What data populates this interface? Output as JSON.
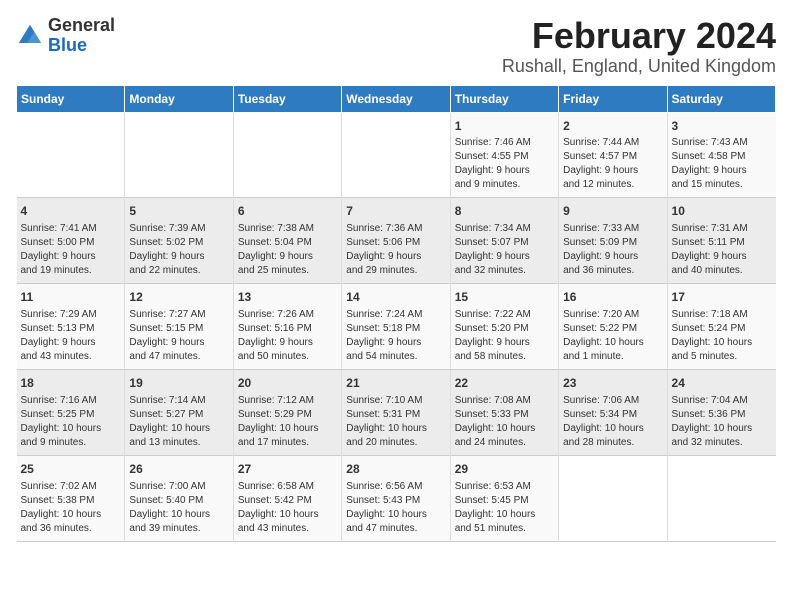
{
  "logo": {
    "general": "General",
    "blue": "Blue"
  },
  "title": "February 2024",
  "location": "Rushall, England, United Kingdom",
  "days_of_week": [
    "Sunday",
    "Monday",
    "Tuesday",
    "Wednesday",
    "Thursday",
    "Friday",
    "Saturday"
  ],
  "weeks": [
    [
      {
        "day": "",
        "content": ""
      },
      {
        "day": "",
        "content": ""
      },
      {
        "day": "",
        "content": ""
      },
      {
        "day": "",
        "content": ""
      },
      {
        "day": "1",
        "content": "Sunrise: 7:46 AM\nSunset: 4:55 PM\nDaylight: 9 hours\nand 9 minutes."
      },
      {
        "day": "2",
        "content": "Sunrise: 7:44 AM\nSunset: 4:57 PM\nDaylight: 9 hours\nand 12 minutes."
      },
      {
        "day": "3",
        "content": "Sunrise: 7:43 AM\nSunset: 4:58 PM\nDaylight: 9 hours\nand 15 minutes."
      }
    ],
    [
      {
        "day": "4",
        "content": "Sunrise: 7:41 AM\nSunset: 5:00 PM\nDaylight: 9 hours\nand 19 minutes."
      },
      {
        "day": "5",
        "content": "Sunrise: 7:39 AM\nSunset: 5:02 PM\nDaylight: 9 hours\nand 22 minutes."
      },
      {
        "day": "6",
        "content": "Sunrise: 7:38 AM\nSunset: 5:04 PM\nDaylight: 9 hours\nand 25 minutes."
      },
      {
        "day": "7",
        "content": "Sunrise: 7:36 AM\nSunset: 5:06 PM\nDaylight: 9 hours\nand 29 minutes."
      },
      {
        "day": "8",
        "content": "Sunrise: 7:34 AM\nSunset: 5:07 PM\nDaylight: 9 hours\nand 32 minutes."
      },
      {
        "day": "9",
        "content": "Sunrise: 7:33 AM\nSunset: 5:09 PM\nDaylight: 9 hours\nand 36 minutes."
      },
      {
        "day": "10",
        "content": "Sunrise: 7:31 AM\nSunset: 5:11 PM\nDaylight: 9 hours\nand 40 minutes."
      }
    ],
    [
      {
        "day": "11",
        "content": "Sunrise: 7:29 AM\nSunset: 5:13 PM\nDaylight: 9 hours\nand 43 minutes."
      },
      {
        "day": "12",
        "content": "Sunrise: 7:27 AM\nSunset: 5:15 PM\nDaylight: 9 hours\nand 47 minutes."
      },
      {
        "day": "13",
        "content": "Sunrise: 7:26 AM\nSunset: 5:16 PM\nDaylight: 9 hours\nand 50 minutes."
      },
      {
        "day": "14",
        "content": "Sunrise: 7:24 AM\nSunset: 5:18 PM\nDaylight: 9 hours\nand 54 minutes."
      },
      {
        "day": "15",
        "content": "Sunrise: 7:22 AM\nSunset: 5:20 PM\nDaylight: 9 hours\nand 58 minutes."
      },
      {
        "day": "16",
        "content": "Sunrise: 7:20 AM\nSunset: 5:22 PM\nDaylight: 10 hours\nand 1 minute."
      },
      {
        "day": "17",
        "content": "Sunrise: 7:18 AM\nSunset: 5:24 PM\nDaylight: 10 hours\nand 5 minutes."
      }
    ],
    [
      {
        "day": "18",
        "content": "Sunrise: 7:16 AM\nSunset: 5:25 PM\nDaylight: 10 hours\nand 9 minutes."
      },
      {
        "day": "19",
        "content": "Sunrise: 7:14 AM\nSunset: 5:27 PM\nDaylight: 10 hours\nand 13 minutes."
      },
      {
        "day": "20",
        "content": "Sunrise: 7:12 AM\nSunset: 5:29 PM\nDaylight: 10 hours\nand 17 minutes."
      },
      {
        "day": "21",
        "content": "Sunrise: 7:10 AM\nSunset: 5:31 PM\nDaylight: 10 hours\nand 20 minutes."
      },
      {
        "day": "22",
        "content": "Sunrise: 7:08 AM\nSunset: 5:33 PM\nDaylight: 10 hours\nand 24 minutes."
      },
      {
        "day": "23",
        "content": "Sunrise: 7:06 AM\nSunset: 5:34 PM\nDaylight: 10 hours\nand 28 minutes."
      },
      {
        "day": "24",
        "content": "Sunrise: 7:04 AM\nSunset: 5:36 PM\nDaylight: 10 hours\nand 32 minutes."
      }
    ],
    [
      {
        "day": "25",
        "content": "Sunrise: 7:02 AM\nSunset: 5:38 PM\nDaylight: 10 hours\nand 36 minutes."
      },
      {
        "day": "26",
        "content": "Sunrise: 7:00 AM\nSunset: 5:40 PM\nDaylight: 10 hours\nand 39 minutes."
      },
      {
        "day": "27",
        "content": "Sunrise: 6:58 AM\nSunset: 5:42 PM\nDaylight: 10 hours\nand 43 minutes."
      },
      {
        "day": "28",
        "content": "Sunrise: 6:56 AM\nSunset: 5:43 PM\nDaylight: 10 hours\nand 47 minutes."
      },
      {
        "day": "29",
        "content": "Sunrise: 6:53 AM\nSunset: 5:45 PM\nDaylight: 10 hours\nand 51 minutes."
      },
      {
        "day": "",
        "content": ""
      },
      {
        "day": "",
        "content": ""
      }
    ]
  ]
}
